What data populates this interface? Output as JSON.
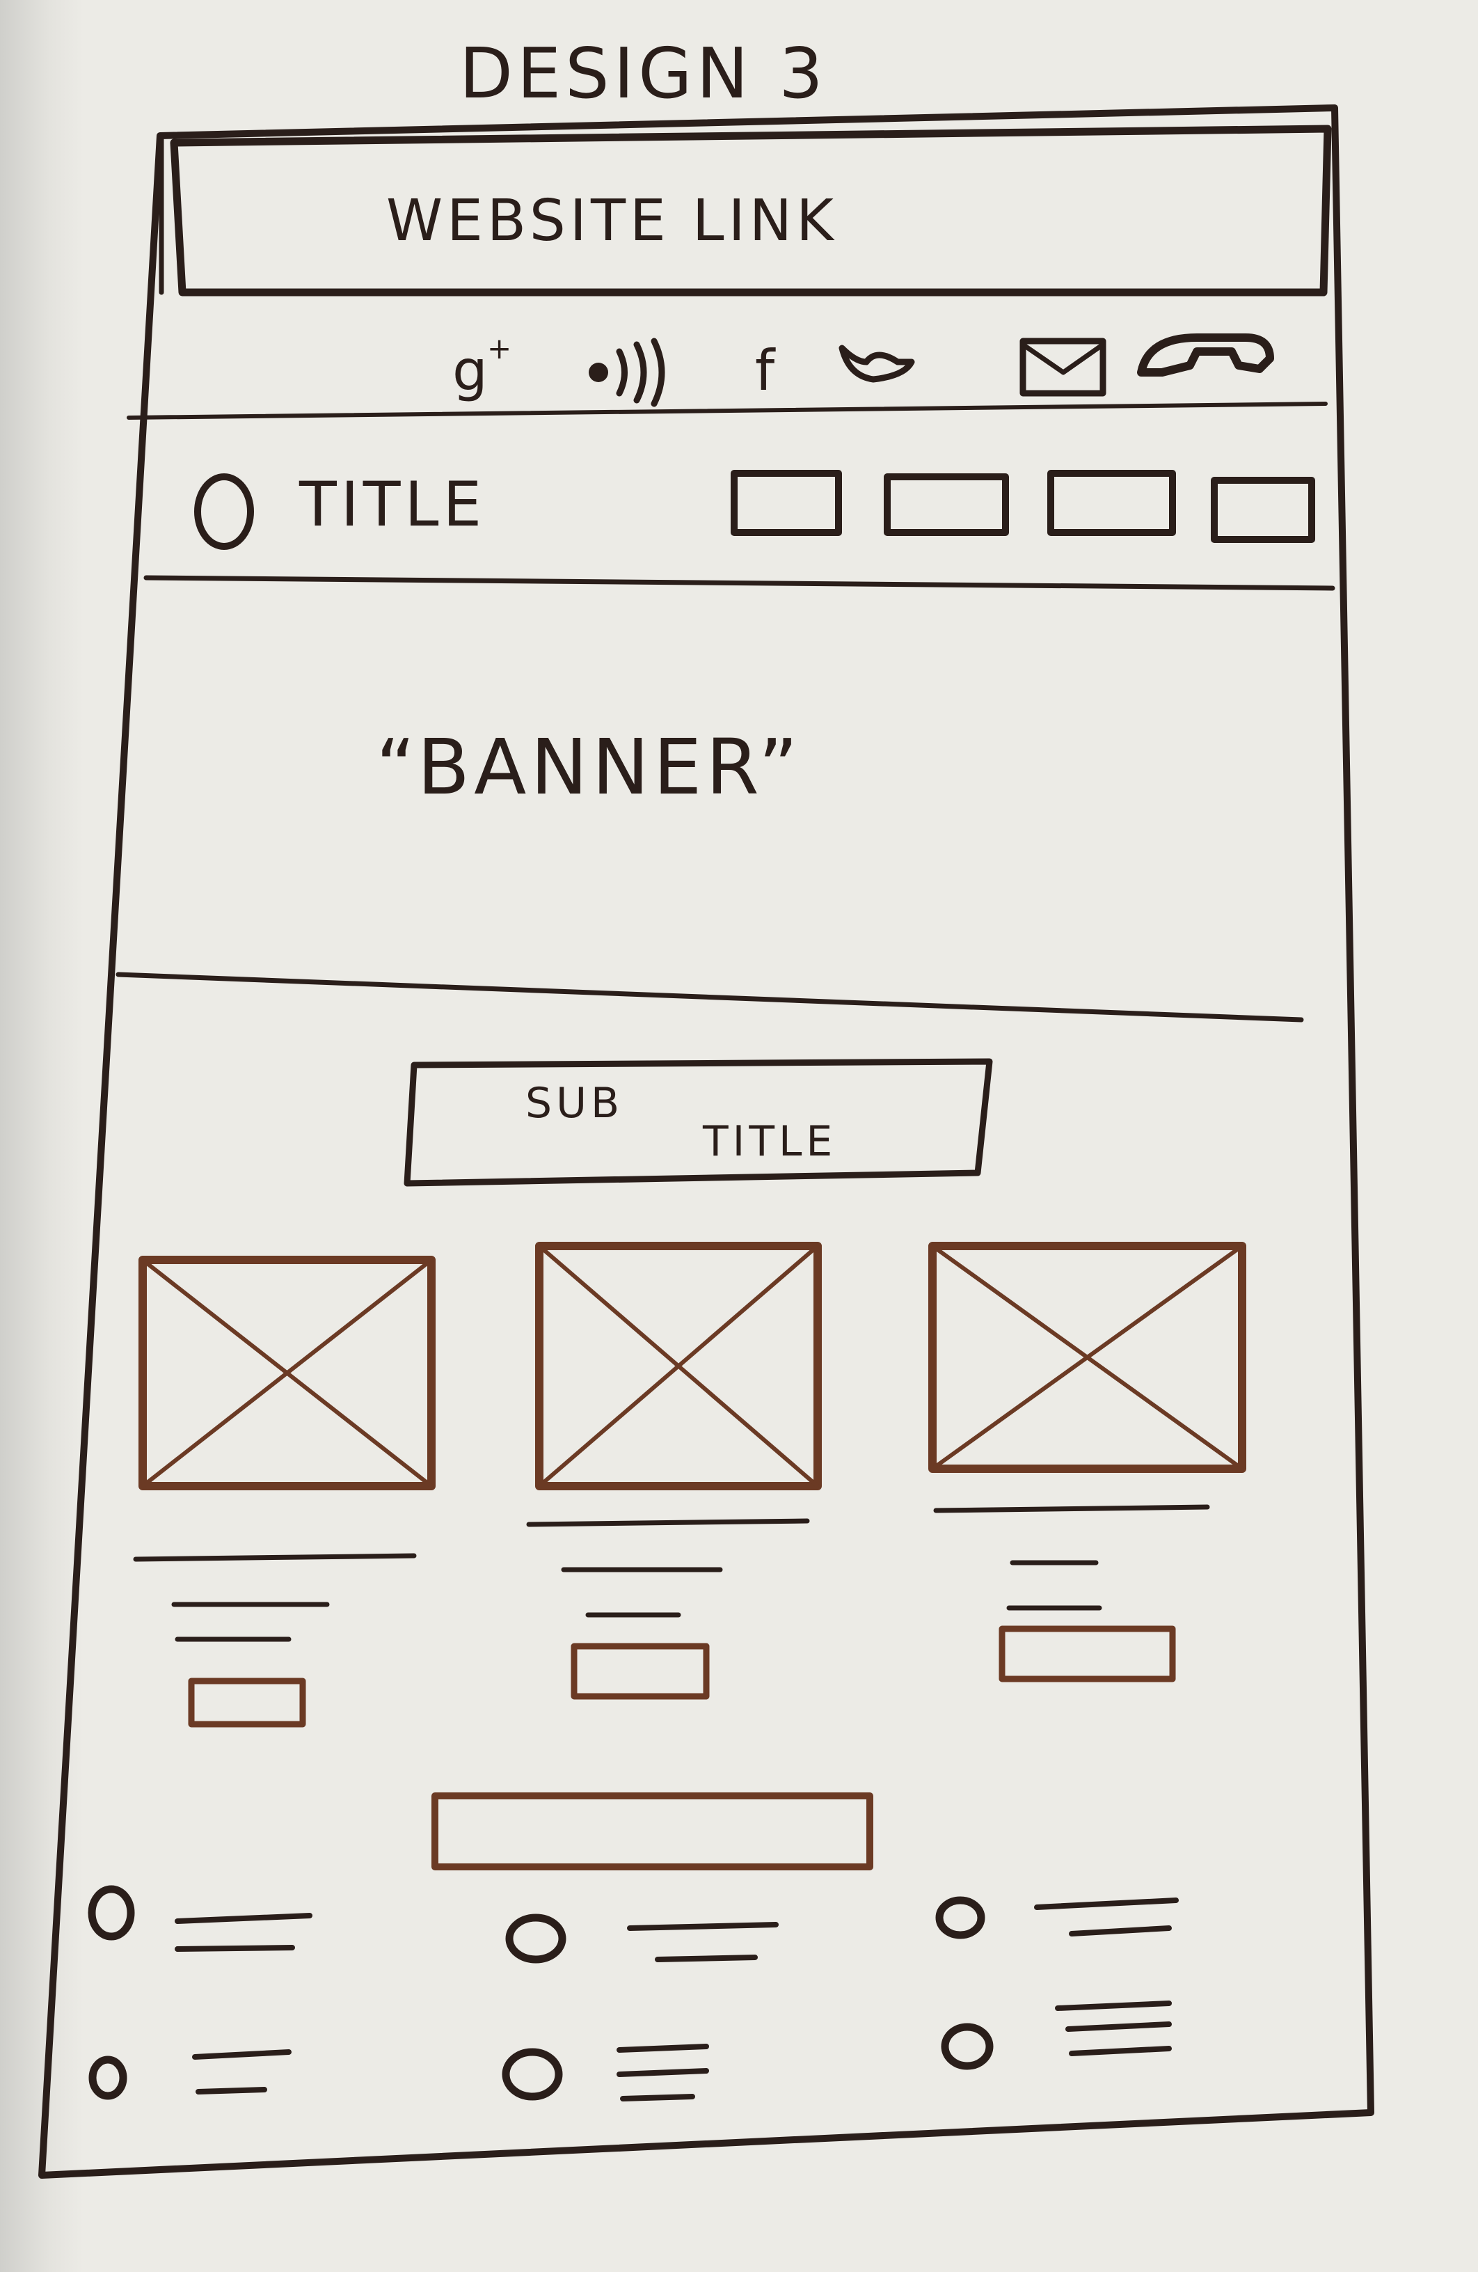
{
  "heading": "DESIGN 3",
  "website_link": {
    "label": "WEBSITE LINK"
  },
  "social_icons": [
    "google-plus-icon",
    "rss-icon",
    "facebook-icon",
    "twitter-icon",
    "mail-icon",
    "phone-icon"
  ],
  "social_glyphs": {
    "google_plus": "g",
    "google_plus_sup": "+",
    "facebook": "f"
  },
  "nav": {
    "title": "TITLE",
    "items_count": 4
  },
  "banner": {
    "label": "“BANNER”"
  },
  "subtitle": {
    "line1": "SUB",
    "line2": "TITLE"
  },
  "cards_count": 3,
  "list_rows": 2,
  "list_cols": 3,
  "colors": {
    "ink": "#2a1e1a",
    "copper_ink": "#6b3a24",
    "paper": "#ecebe6",
    "background": "#1f5d22"
  }
}
